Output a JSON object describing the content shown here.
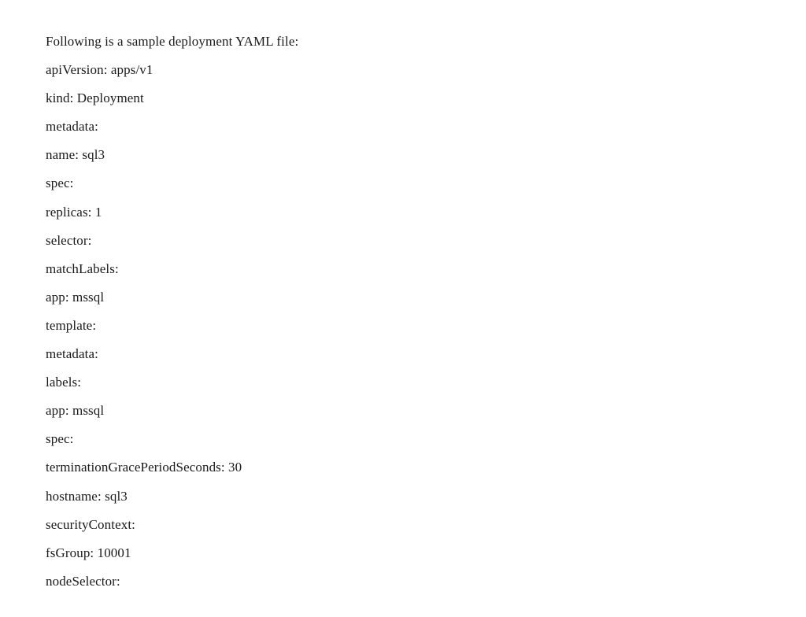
{
  "doc": {
    "intro": "Following is a sample deployment YAML file:",
    "lines": [
      "apiVersion: apps/v1",
      "kind: Deployment",
      "metadata:",
      "name: sql3",
      "spec:",
      "replicas: 1",
      "selector:",
      "matchLabels:",
      "app: mssql",
      "template:",
      "metadata:",
      "labels:",
      "app: mssql",
      "spec:",
      "terminationGracePeriodSeconds: 30",
      "hostname: sql3",
      "securityContext:",
      "fsGroup: 10001",
      "nodeSelector:"
    ]
  }
}
